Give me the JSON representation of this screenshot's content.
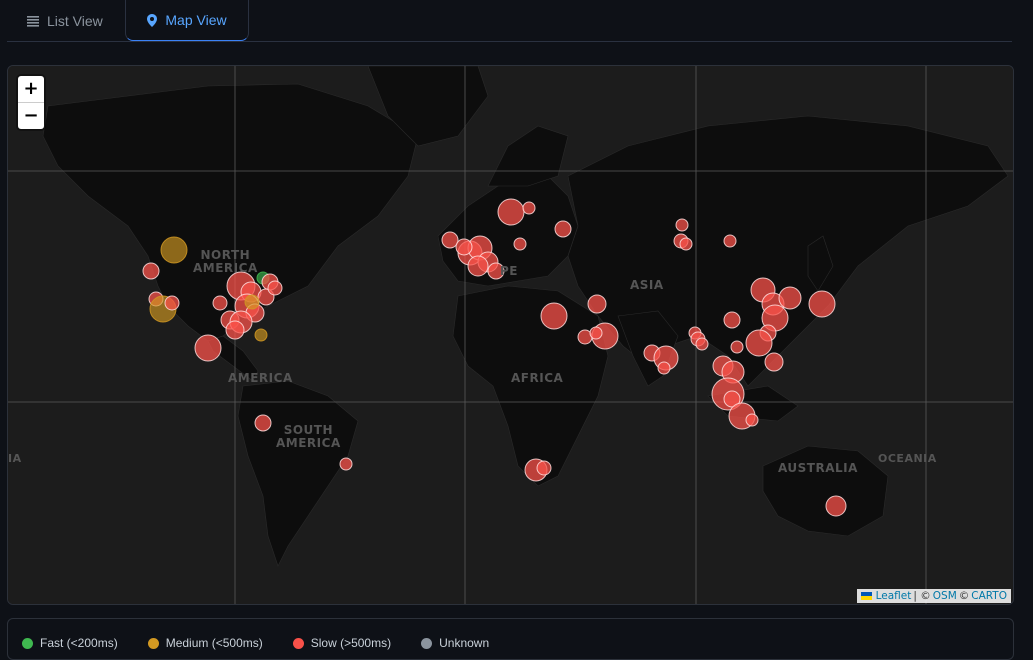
{
  "tabs": [
    {
      "label": "List View",
      "icon": "list-icon",
      "active": false
    },
    {
      "label": "Map View",
      "icon": "map-pin-icon",
      "active": true
    }
  ],
  "map": {
    "zoom_in": "+",
    "zoom_out": "−",
    "labels": {
      "north_america_1": "NORTH",
      "north_america_2": "AMERICA",
      "south_america_1": "SOUTH",
      "south_america_2": "AMERICA",
      "europe": "PE",
      "asia": "ASIA",
      "africa": "AFRICA",
      "australia": "AUSTRALIA",
      "oceania": "OCEANIA",
      "edge": "IA"
    },
    "attribution": {
      "leaflet": "Leaflet",
      "sep1": "| ©",
      "osm": "OSM",
      "sep2": "©",
      "carto": "CARTO"
    }
  },
  "legend": [
    {
      "label": "Fast (<200ms)",
      "color": "#3fb950"
    },
    {
      "label": "Medium (<500ms)",
      "color": "#d29922"
    },
    {
      "label": "Slow (>500ms)",
      "color": "#f85149"
    },
    {
      "label": "Unknown",
      "color": "#8b949e"
    }
  ],
  "colors": {
    "slow": "#f85149",
    "medium": "#d29922",
    "fast": "#3fb950"
  }
}
